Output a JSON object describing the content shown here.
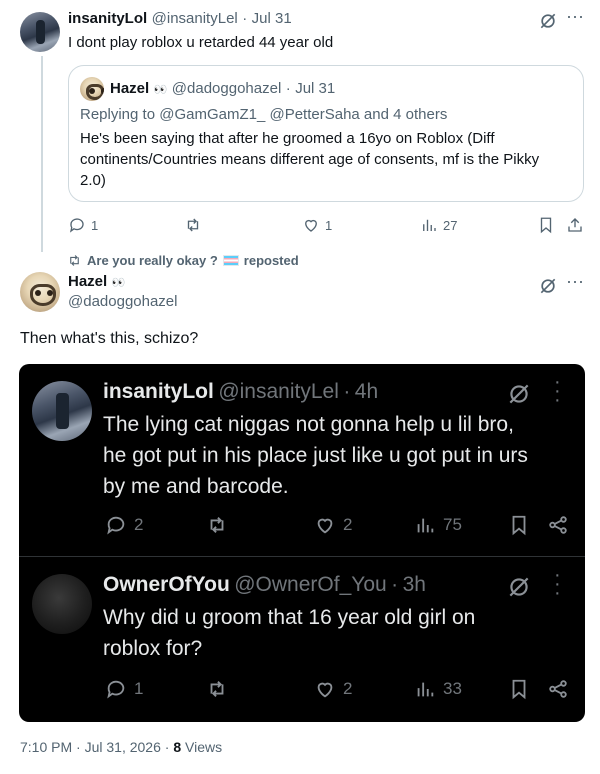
{
  "reply_tweet": {
    "display_name": "insanityLol",
    "handle": "@insanityLel",
    "separator": "·",
    "date": "Jul 31",
    "text": "I dont play roblox u retarded 44 year old"
  },
  "quoted_tweet": {
    "display_name": "Hazel",
    "name_emoji": "👀",
    "handle": "@dadoggohazel",
    "separator": "·",
    "date": "Jul 31",
    "replying_prefix": "Replying to",
    "replying_users": "@GamGamZ1_ @PetterSaha",
    "replying_suffix": "and 4 others",
    "text_line1": "He's been saying that after he groomed a 16yo on Roblox (Diff",
    "text_line2": "continents/Countries means different age of consents, mf is the Pikky",
    "text_line3": "2.0)"
  },
  "reply_actions": {
    "replies": "1",
    "likes": "1",
    "views": "27"
  },
  "repost_banner": {
    "text_before": "Are you really okay ?",
    "flag_icon": "transgender-flag-icon",
    "text_after": "reposted"
  },
  "main_tweet": {
    "display_name": "Hazel",
    "name_emoji": "👀",
    "handle": "@dadoggohazel",
    "text": "Then what's this, schizo?",
    "timestamp": "7:10 PM · Jul 31, 2026",
    "separator": "·",
    "views_count": "8",
    "views_label": "Views"
  },
  "screenshot_tweet_1": {
    "display_name": "insanityLol",
    "handle": "@insanityLel",
    "separator": "·",
    "time": "4h",
    "text_line1": "The lying cat niggas not gonna help u lil bro,",
    "text_line2": "he got put in his place just like u got put in urs",
    "text_line3": "by me and barcode.",
    "replies": "2",
    "likes": "2",
    "views": "75"
  },
  "screenshot_tweet_2": {
    "display_name": "OwnerOfYou",
    "handle": "@OwnerOf_You",
    "separator": "·",
    "time": "3h",
    "text_line1": "Why did u groom that 16 year old girl on",
    "text_line2": "roblox for?",
    "replies": "1",
    "likes": "2",
    "views": "33"
  },
  "colors": {
    "text": "#0f1419",
    "muted": "#536471",
    "border": "#cfd9de",
    "dark_bg": "#000000",
    "dark_text": "#e7e9ea",
    "dark_muted": "#71767b"
  }
}
